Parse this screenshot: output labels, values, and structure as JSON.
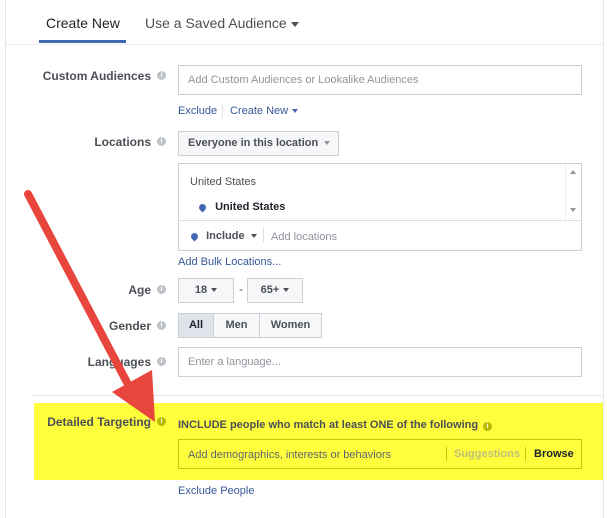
{
  "tabs": [
    {
      "label": "Create New"
    },
    {
      "label": "Use a Saved Audience"
    }
  ],
  "custom_audiences": {
    "label": "Custom Audiences",
    "placeholder": "Add Custom Audiences or Lookalike Audiences",
    "exclude": "Exclude",
    "create_new": "Create New"
  },
  "locations": {
    "label": "Locations",
    "dropdown": "Everyone in this location",
    "group_header": "United States",
    "selected": "United States",
    "include": "Include",
    "add_placeholder": "Add locations",
    "bulk_link": "Add Bulk Locations..."
  },
  "age": {
    "label": "Age",
    "min": "18",
    "dash": "-",
    "max": "65+"
  },
  "gender": {
    "label": "Gender",
    "options": [
      "All",
      "Men",
      "Women"
    ],
    "selected": "All"
  },
  "languages": {
    "label": "Languages",
    "placeholder": "Enter a language..."
  },
  "detailed_targeting": {
    "label": "Detailed Targeting",
    "instruction": "INCLUDE people who match at least ONE of the following",
    "placeholder": "Add demographics, interests or behaviors",
    "suggestions": "Suggestions",
    "browse": "Browse",
    "exclude_link": "Exclude People"
  },
  "colors": {
    "accent": "#4267b2",
    "highlight": "#fefe3c",
    "arrow": "#e8453c"
  }
}
